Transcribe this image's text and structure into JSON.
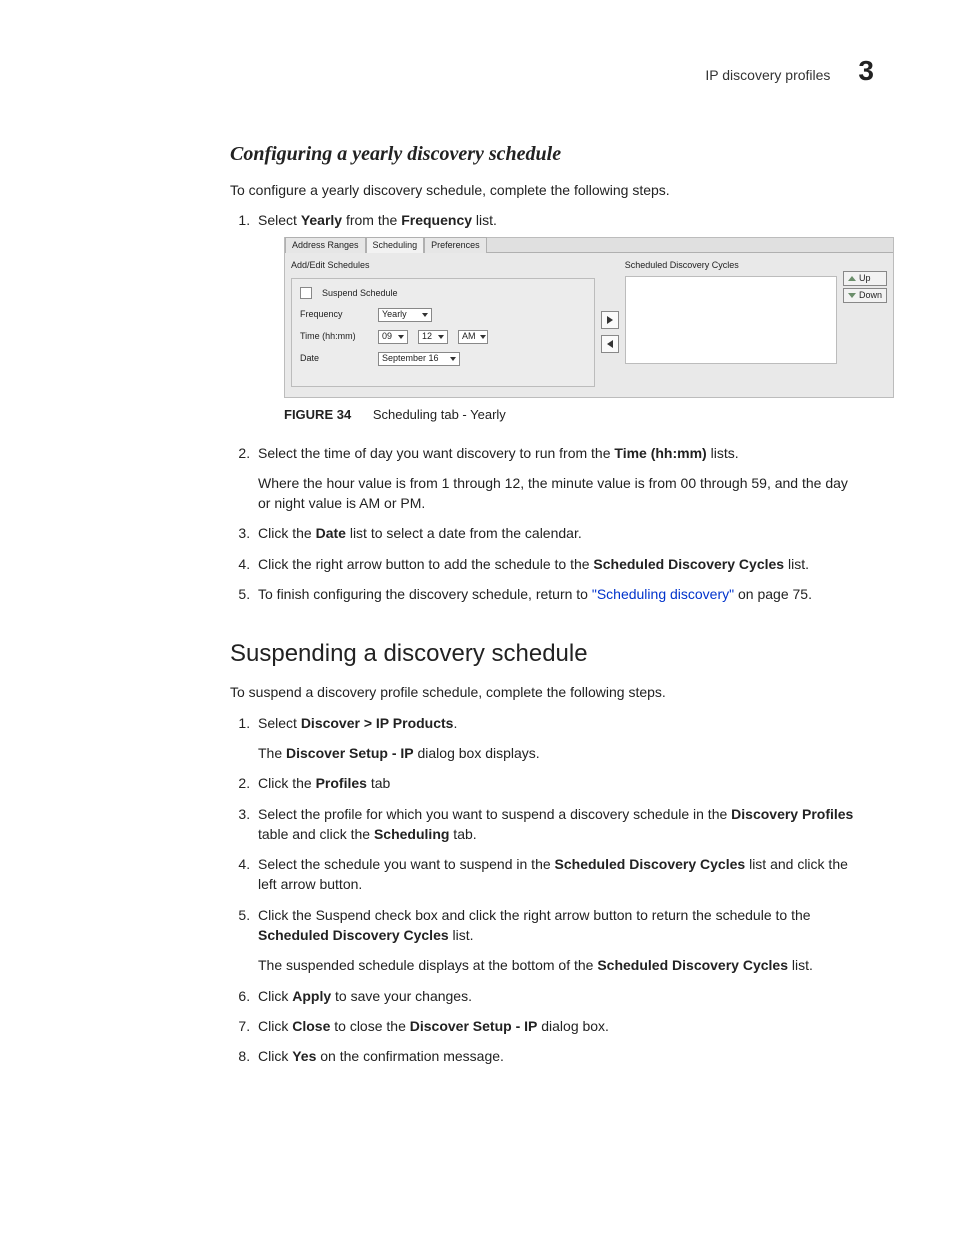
{
  "header": {
    "text": "IP discovery profiles",
    "chapter": "3"
  },
  "section1": {
    "title": "Configuring a yearly discovery schedule",
    "intro": "To configure a yearly discovery schedule, complete the following steps.",
    "steps": {
      "s1_a": "Select ",
      "s1_b": "Yearly",
      "s1_c": " from the ",
      "s1_d": "Frequency",
      "s1_e": " list.",
      "s2_a": "Select the time of day you want discovery to run from the ",
      "s2_b": "Time (hh:mm)",
      "s2_c": " lists.",
      "s2_note": "Where the hour value is from 1 through 12, the minute value is from 00 through 59, and the day or night value is AM or PM.",
      "s3_a": "Click the ",
      "s3_b": "Date",
      "s3_c": " list to select a date from the calendar.",
      "s4_a": "Click the right arrow button to add the schedule to the ",
      "s4_b": "Scheduled Discovery Cycles",
      "s4_c": " list.",
      "s5_a": "To finish configuring the discovery schedule, return to ",
      "s5_link": "\"Scheduling discovery\"",
      "s5_b": " on page 75."
    },
    "figure": {
      "label": "FIGURE 34",
      "caption": "Scheduling tab - Yearly"
    }
  },
  "ui": {
    "tabs": {
      "t1": "Address Ranges",
      "t2": "Scheduling",
      "t3": "Preferences"
    },
    "left_title": "Add/Edit Schedules",
    "suspend": "Suspend Schedule",
    "freq_label": "Frequency",
    "freq_value": "Yearly",
    "time_label": "Time (hh:mm)",
    "hh": "09",
    "mm": "12",
    "ampm": "AM",
    "date_label": "Date",
    "date_value": "September 16",
    "right_title": "Scheduled Discovery Cycles",
    "up": "Up",
    "down": "Down"
  },
  "section2": {
    "title": "Suspending a discovery schedule",
    "intro": "To suspend a discovery profile schedule, complete the following steps.",
    "steps": {
      "s1_a": "Select ",
      "s1_b": "Discover > IP Products",
      "s1_c": ".",
      "s1_note_a": "The ",
      "s1_note_b": "Discover Setup - IP",
      "s1_note_c": " dialog box displays.",
      "s2_a": "Click the ",
      "s2_b": "Profiles",
      "s2_c": " tab",
      "s3_a": "Select the profile for which you want to suspend a discovery schedule in the ",
      "s3_b": "Discovery Profiles",
      "s3_c": " table and click the ",
      "s3_d": "Scheduling",
      "s3_e": " tab.",
      "s4_a": "Select the schedule you want to suspend in the ",
      "s4_b": "Scheduled Discovery Cycles",
      "s4_c": " list and click the left arrow button.",
      "s5_a": "Click the Suspend check box and click the right arrow button to return the schedule to the ",
      "s5_b": "Scheduled Discovery Cycles",
      "s5_c": " list.",
      "s5_note_a": "The suspended schedule displays at the bottom of the ",
      "s5_note_b": "Scheduled Discovery Cycles",
      "s5_note_c": " list.",
      "s6_a": "Click ",
      "s6_b": "Apply",
      "s6_c": " to save your changes.",
      "s7_a": "Click ",
      "s7_b": "Close",
      "s7_c": " to close the ",
      "s7_d": "Discover Setup - IP",
      "s7_e": " dialog box.",
      "s8_a": "Click ",
      "s8_b": "Yes",
      "s8_c": " on the confirmation message."
    }
  }
}
